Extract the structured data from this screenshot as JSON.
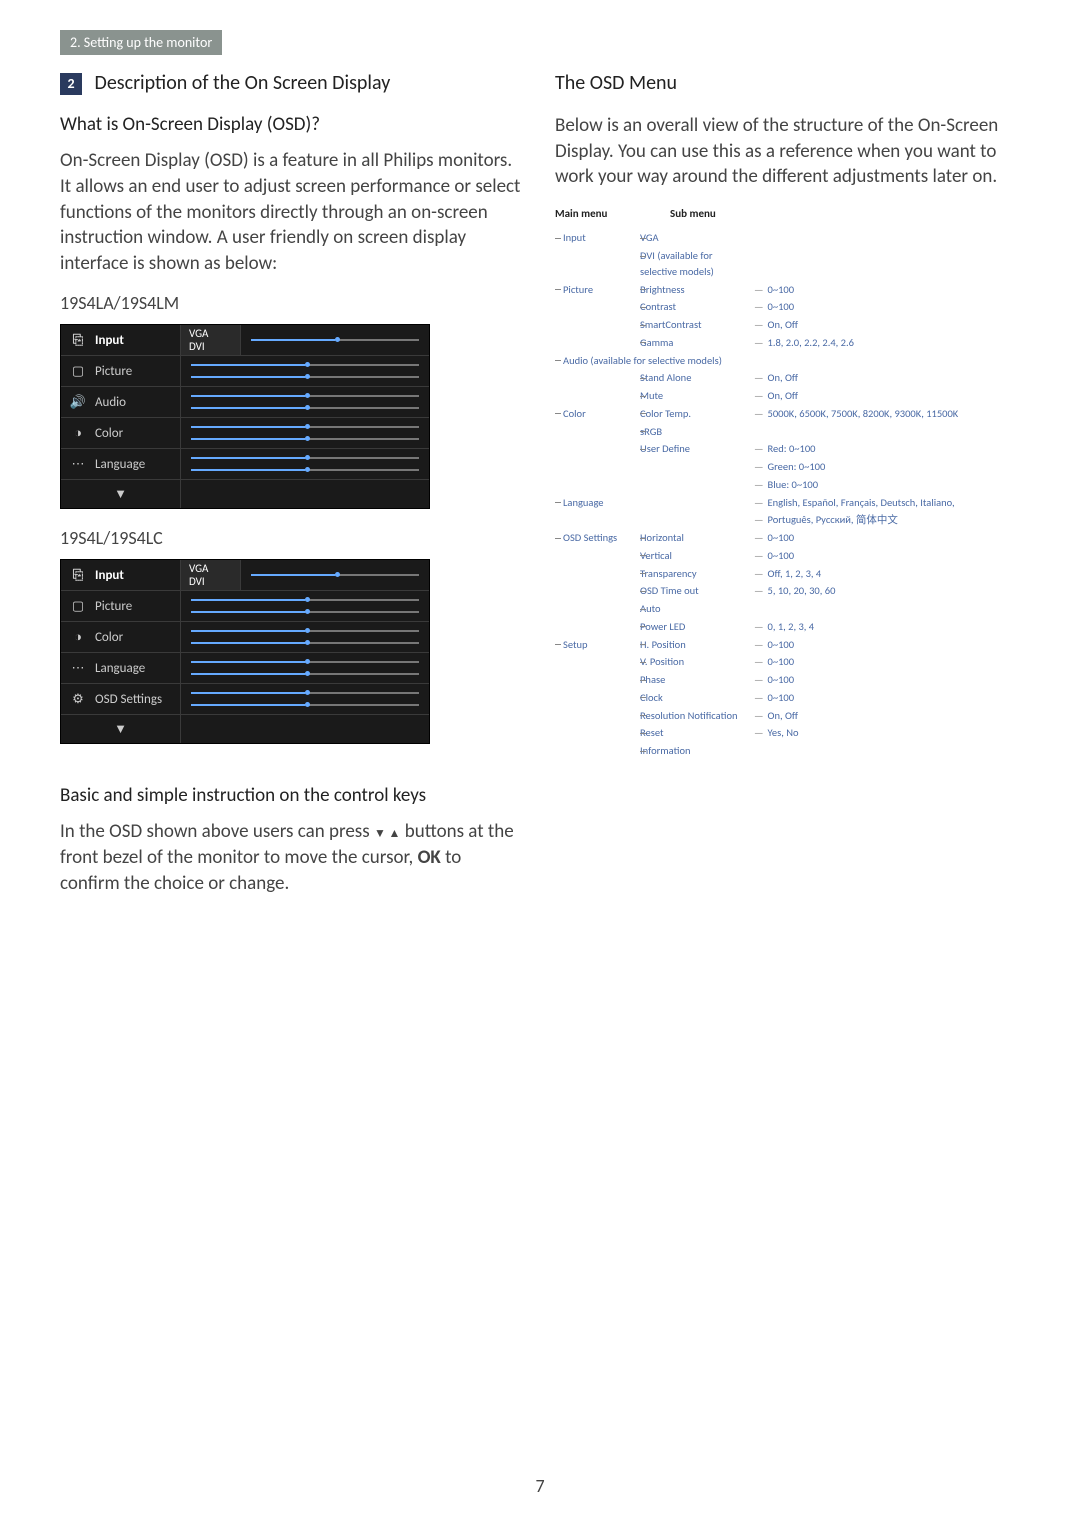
{
  "breadcrumb": "2. Setting up the monitor",
  "section_number": "2",
  "left": {
    "title": "Description of the On Screen Display",
    "q": "What is On-Screen Display (OSD)?",
    "p1": "On-Screen Display (OSD) is a feature in all Philips monitors. It allows an end user to adjust screen performance or select functions of the monitors directly through an on-screen instruction window. A user friendly on screen display interface is shown as below:",
    "model1": "19S4LA/19S4LM",
    "model2": "19S4L/19S4LC",
    "osd1_items": [
      "Input",
      "Picture",
      "Audio",
      "Color",
      "Language"
    ],
    "osd1_sub": [
      "VGA",
      "DVI"
    ],
    "osd2_items": [
      "Input",
      "Picture",
      "Color",
      "Language",
      "OSD Settings"
    ],
    "osd2_sub": [
      "VGA",
      "DVI"
    ],
    "down_arrow": "▼",
    "basic_h": "Basic and simple instruction on the control keys",
    "basic_p_a": "In the OSD shown above users can press ",
    "basic_p_b": " buttons at the front bezel of the monitor to move the cursor, ",
    "basic_ok": "OK",
    "basic_p_c": " to confirm the choice or change.",
    "arrows": "▼ ▲"
  },
  "right": {
    "title": "The OSD Menu",
    "p": "Below is an overall view of the structure of the On-Screen Display. You can use this as a reference when you want to work your way around the different adjustments later on.",
    "hdr_main": "Main menu",
    "hdr_sub": "Sub menu",
    "tree": [
      {
        "c1": "Input",
        "c2": "VGA",
        "c3": ""
      },
      {
        "c1": "",
        "c2": "DVI (available for selective models)",
        "c3": ""
      },
      {
        "c1": "Picture",
        "c2": "Brightness",
        "c3": "0~100"
      },
      {
        "c1": "",
        "c2": "Contrast",
        "c3": "0~100"
      },
      {
        "c1": "",
        "c2": "SmartContrast",
        "c3": "On, Off"
      },
      {
        "c1": "",
        "c2": "Gamma",
        "c3": "1.8, 2.0, 2.2, 2.4, 2.6"
      },
      {
        "c1": "Audio (available for selective models)",
        "c2": "",
        "c3": ""
      },
      {
        "c1": "",
        "c2": "Stand Alone",
        "c3": "On, Off"
      },
      {
        "c1": "",
        "c2": "Mute",
        "c3": "On, Off"
      },
      {
        "c1": "Color",
        "c2": "Color Temp.",
        "c3": "5000K, 6500K, 7500K, 8200K, 9300K, 11500K"
      },
      {
        "c1": "",
        "c2": "sRGB",
        "c3": ""
      },
      {
        "c1": "",
        "c2": "User Define",
        "c3": "Red: 0~100"
      },
      {
        "c1": "",
        "c2": "",
        "c3": "Green: 0~100"
      },
      {
        "c1": "",
        "c2": "",
        "c3": "Blue: 0~100"
      },
      {
        "c1": "Language",
        "c2": "",
        "c3": "English, Español, Français, Deutsch, Italiano,"
      },
      {
        "c1": "",
        "c2": "",
        "c3": "Português, Русский, 简体中文"
      },
      {
        "c1": "OSD Settings",
        "c2": "Horizontal",
        "c3": "0~100"
      },
      {
        "c1": "",
        "c2": "Vertical",
        "c3": "0~100"
      },
      {
        "c1": "",
        "c2": "Transparency",
        "c3": "Off, 1, 2, 3, 4"
      },
      {
        "c1": "",
        "c2": "OSD Time out",
        "c3": "5, 10, 20, 30, 60"
      },
      {
        "c1": "",
        "c2": "Auto",
        "c3": ""
      },
      {
        "c1": "",
        "c2": "Power LED",
        "c3": "0, 1, 2, 3, 4"
      },
      {
        "c1": "Setup",
        "c2": "H. Position",
        "c3": "0~100"
      },
      {
        "c1": "",
        "c2": "V. Position",
        "c3": "0~100"
      },
      {
        "c1": "",
        "c2": "Phase",
        "c3": "0~100"
      },
      {
        "c1": "",
        "c2": "Clock",
        "c3": "0~100"
      },
      {
        "c1": "",
        "c2": "Resolution Notification",
        "c3": "On, Off"
      },
      {
        "c1": "",
        "c2": "Reset",
        "c3": "Yes, No"
      },
      {
        "c1": "",
        "c2": "Information",
        "c3": ""
      }
    ]
  },
  "page_number": "7"
}
